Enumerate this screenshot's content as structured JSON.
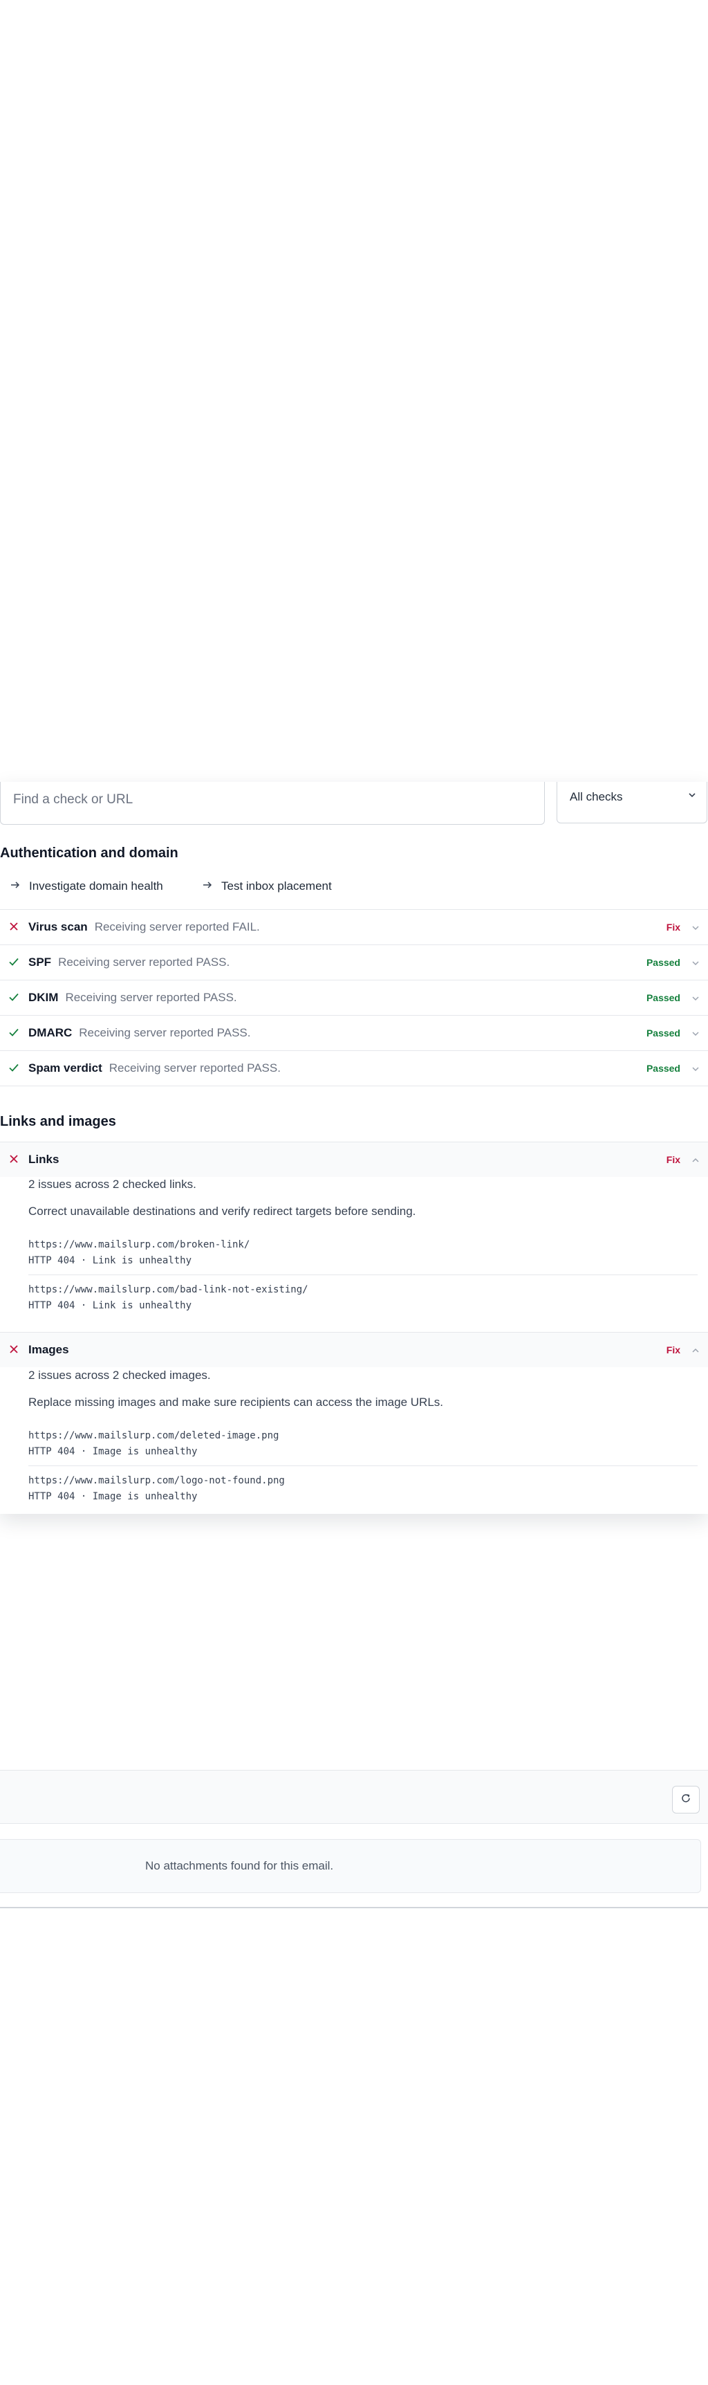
{
  "search": {
    "placeholder": "Find a check or URL"
  },
  "filter": {
    "selected": "All checks"
  },
  "auth_section": {
    "title": "Authentication and domain",
    "actions": [
      {
        "label": "Investigate domain health",
        "icon": "arrow-right-icon"
      },
      {
        "label": "Test inbox placement",
        "icon": "arrow-right-icon"
      }
    ],
    "checks": [
      {
        "name": "Virus scan",
        "detail": "Receiving server reported FAIL.",
        "status": "Fix",
        "result": "fail"
      },
      {
        "name": "SPF",
        "detail": "Receiving server reported PASS.",
        "status": "Passed",
        "result": "pass"
      },
      {
        "name": "DKIM",
        "detail": "Receiving server reported PASS.",
        "status": "Passed",
        "result": "pass"
      },
      {
        "name": "DMARC",
        "detail": "Receiving server reported PASS.",
        "status": "Passed",
        "result": "pass"
      },
      {
        "name": "Spam verdict",
        "detail": "Receiving server reported PASS.",
        "status": "Passed",
        "result": "pass"
      }
    ]
  },
  "links_section": {
    "title": "Links and images",
    "links": {
      "name": "Links",
      "status": "Fix",
      "summary": "2 issues across 2 checked links.",
      "advice": "Correct unavailable destinations and verify redirect targets before sending.",
      "items": [
        {
          "url": "https://www.mailslurp.com/broken-link/",
          "result": "HTTP 404 · Link is unhealthy"
        },
        {
          "url": "https://www.mailslurp.com/bad-link-not-existing/",
          "result": "HTTP 404 · Link is unhealthy"
        }
      ]
    },
    "images": {
      "name": "Images",
      "status": "Fix",
      "summary": "2 issues across 2 checked images.",
      "advice": "Replace missing images and make sure recipients can access the image URLs.",
      "items": [
        {
          "url": "https://www.mailslurp.com/deleted-image.png",
          "result": "HTTP 404 · Image is unhealthy"
        },
        {
          "url": "https://www.mailslurp.com/logo-not-found.png",
          "result": "HTTP 404 · Image is unhealthy"
        }
      ]
    }
  },
  "attachments": {
    "empty_message": "No attachments found for this email."
  },
  "colors": {
    "fail": "#be123c",
    "pass": "#15803d",
    "muted": "#6b7280"
  }
}
